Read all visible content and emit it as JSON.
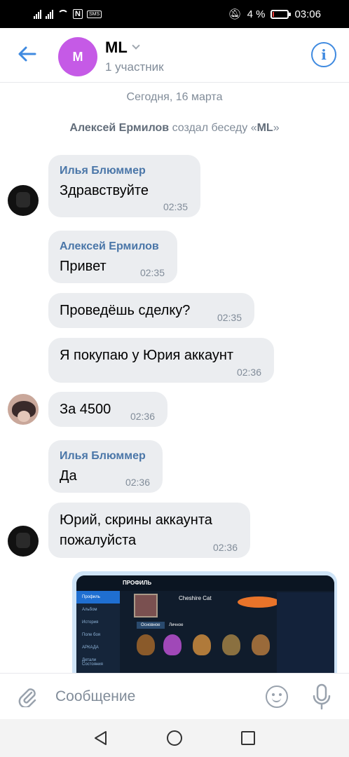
{
  "status_bar": {
    "battery": "4 %",
    "time": "03:06",
    "nfc": "N",
    "sms": "SMS"
  },
  "header": {
    "avatar_letter": "M",
    "title": "ML",
    "subtitle": "1 участник"
  },
  "date_separator": "Сегодня, 16 марта",
  "service_message": {
    "author": "Алексей Ермилов",
    "action": " создал беседу «",
    "chat": "ML",
    "end": "»"
  },
  "messages": [
    {
      "author": "Илья Блюммер",
      "text": "Здравствуйте",
      "time": "02:35"
    },
    {
      "author": "Алексей Ермилов",
      "text": "Привет",
      "time": "02:35"
    },
    {
      "text": "Проведёшь сделку?",
      "time": "02:35"
    },
    {
      "text": "Я покупаю у Юрия аккаунт",
      "time": "02:36"
    },
    {
      "text": "За 4500",
      "time": "02:36"
    },
    {
      "author": "Илья Блюммер",
      "text": "Да",
      "time": "02:36"
    },
    {
      "text_line1": "Юрий, скрины аккаунта",
      "text_line2": "пожалуйста",
      "time": "02:36"
    }
  ],
  "screenshot_preview": {
    "top_label": "ПРОФИЛЬ",
    "player_name": "Cheshire Cat",
    "side_items": [
      "Профиль",
      "Альбом",
      "История",
      "Поле боя",
      "АРКАДА",
      "Детали Состояния"
    ]
  },
  "input": {
    "placeholder": "Сообщение"
  },
  "icons": {
    "back": "arrow-left-icon",
    "info": "info-icon",
    "attach": "paperclip-icon",
    "emoji": "smile-icon",
    "mic": "microphone-icon"
  },
  "colors": {
    "accent": "#3f8ae0",
    "avatar": "#c55ae6",
    "bubble": "#ebedf0",
    "name": "#4a76a8"
  }
}
